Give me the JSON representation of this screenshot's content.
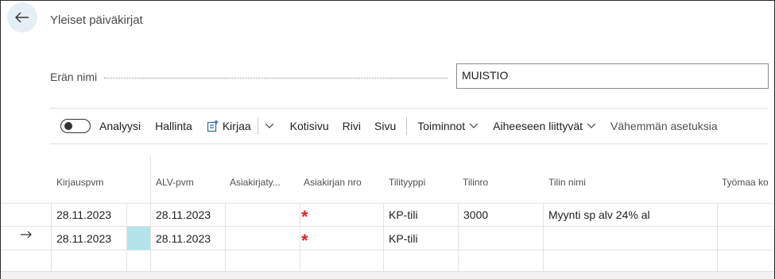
{
  "page": {
    "title": "Yleiset päiväkirjat"
  },
  "batch": {
    "label": "Erän nimi",
    "value": "MUISTIO"
  },
  "toolbar": {
    "analysis": "Analyysi",
    "manage": "Hallinta",
    "post": "Kirjaa",
    "home": "Kotisivu",
    "line": "Rivi",
    "page": "Sivu",
    "actions": "Toiminnot",
    "related": "Aiheeseen liittyvät",
    "fewer": "Vähemmän asetuksia"
  },
  "grid": {
    "headers": [
      "Kirjauspvm",
      "ALV-pvm",
      "Asiakirjaty...",
      "Asiakirjan nro",
      "Tilityyppi",
      "Tilinro",
      "Tilin nimi",
      "Työmaa ko"
    ],
    "rows": [
      {
        "posting_date": "28.11.2023",
        "vat_date": "28.11.2023",
        "doc_no_marker": "*",
        "account_type": "KP-tili",
        "account_no": "3000",
        "account_name": "Myynti sp alv 24% al"
      },
      {
        "posting_date": "28.11.2023",
        "vat_date": "28.11.2023",
        "doc_no_marker": "*",
        "account_type": "KP-tili",
        "account_no": "",
        "account_name": ""
      }
    ]
  },
  "colors": {
    "accent": "#b3e4ec",
    "required": "#e0202a",
    "back_bg": "#e4eef5"
  }
}
